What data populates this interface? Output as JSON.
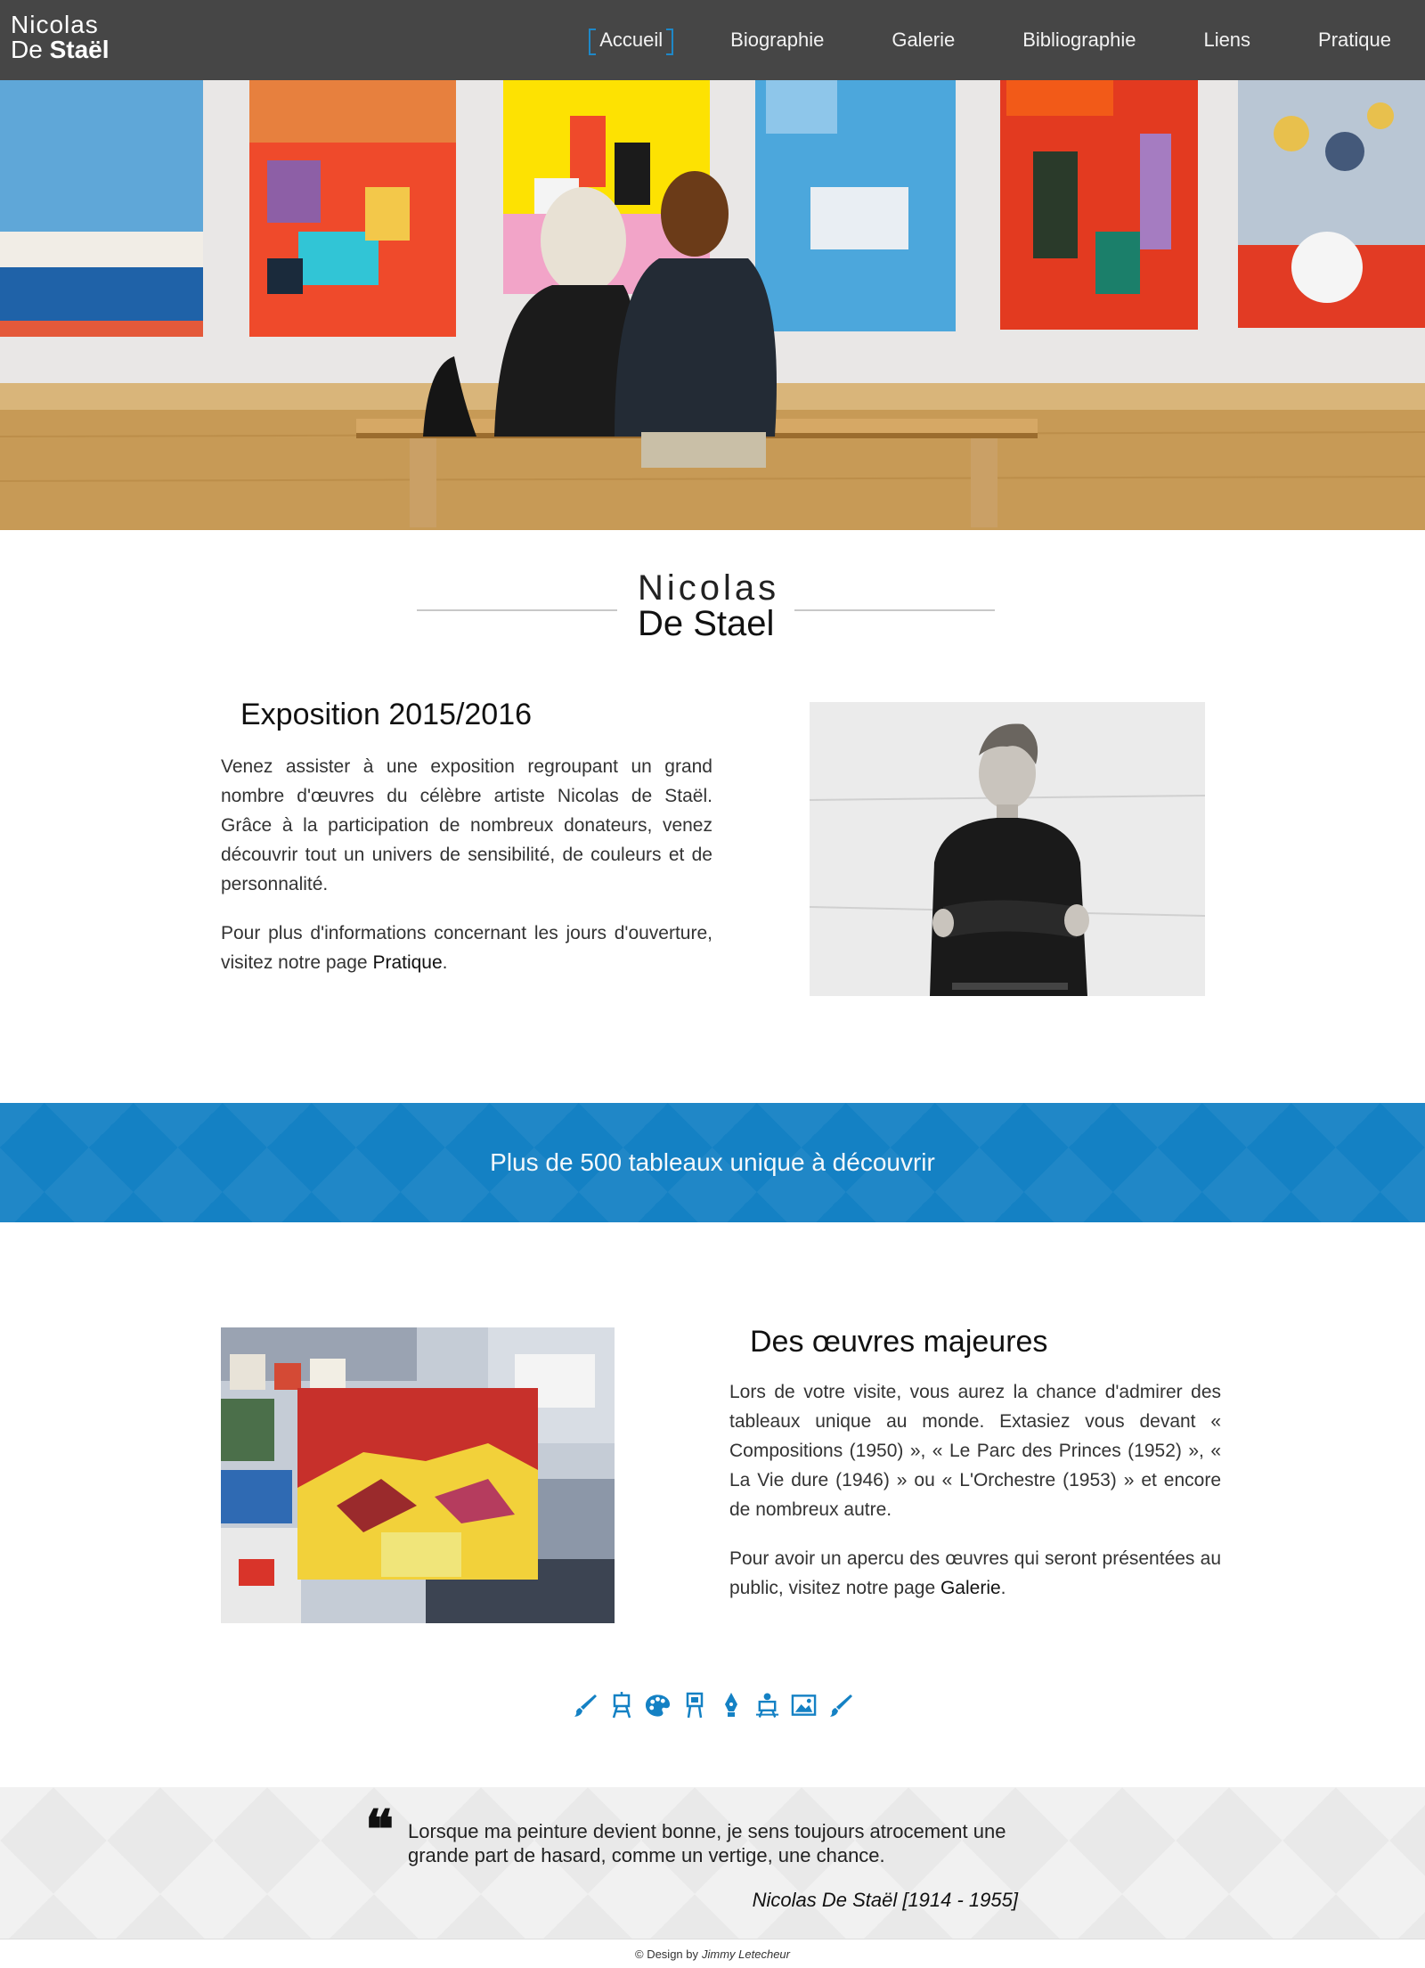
{
  "header": {
    "logo_line1": "Nicolas",
    "logo_line2_a": "De",
    "logo_line2_b": "Staël",
    "nav": [
      {
        "label": "Accueil",
        "active": true
      },
      {
        "label": "Biographie"
      },
      {
        "label": "Galerie"
      },
      {
        "label": "Bibliographie"
      },
      {
        "label": "Liens"
      },
      {
        "label": "Pratique"
      }
    ]
  },
  "title": {
    "line1": "Nicolas",
    "line2": "De Stael"
  },
  "expo": {
    "heading": "Exposition 2015/2016",
    "p1": "Venez assister à une exposition regroupant un grand nombre d'œuvres du célèbre artiste Nicolas de Staël. Grâce à la participation de nombreux donateurs, venez découvrir tout un univers de sensibilité, de couleurs et de personnalité.",
    "p2_before": "Pour plus d'informations concernant les jours d'ouverture, visitez notre page ",
    "p2_link": "Pratique",
    "p2_after": "."
  },
  "banner": {
    "text": "Plus de 500 tableaux unique à découvrir"
  },
  "works": {
    "heading": "Des œuvres majeures",
    "p1": "Lors de votre visite, vous aurez la chance d'admirer des tableaux unique au monde. Extasiez vous devant « Compositions (1950) », « Le Parc des Princes (1952) », « La Vie dure (1946) » ou « L'Orchestre (1953) » et encore de nombreux autre.",
    "p2_before": "Pour avoir un apercu des œuvres qui seront présentées au public, visitez notre page ",
    "p2_link": "Galerie",
    "p2_after": "."
  },
  "icons": [
    "brush-icon",
    "easel-icon",
    "palette-icon",
    "canvas-stand-icon",
    "pen-nib-icon",
    "painter-at-easel-icon",
    "picture-icon",
    "brush-icon"
  ],
  "quote": {
    "mark": "❝",
    "text": "Lorsque ma peinture devient bonne, je sens toujours atrocement une grande part de hasard, comme un vertige, une chance.",
    "author": "Nicolas De Staël [1914 - 1955]"
  },
  "footer": {
    "text": "© Design by",
    "author": "Jimmy Letecheur"
  },
  "colors": {
    "header_bg": "#464646",
    "accent": "#1481c4",
    "quote_bg": "#e9e9e9"
  }
}
